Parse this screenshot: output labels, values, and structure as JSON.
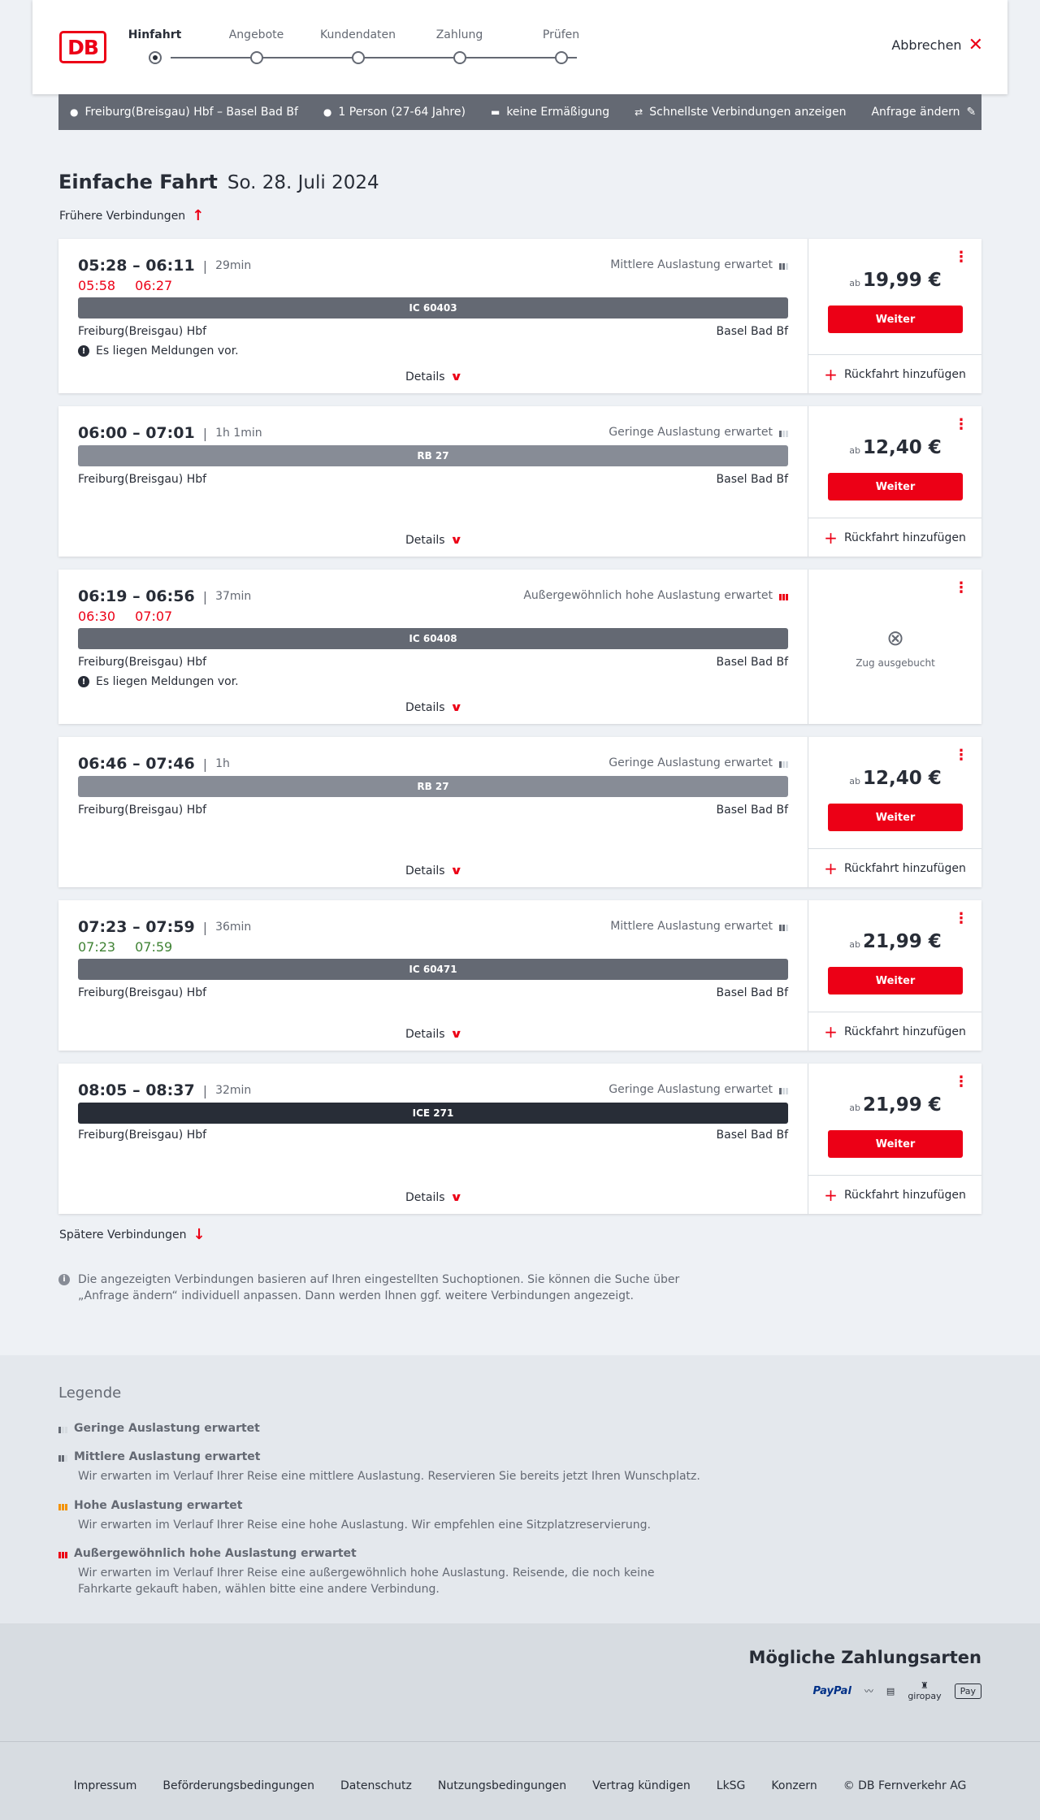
{
  "header": {
    "logo": "DB",
    "steps": [
      "Hinfahrt",
      "Angebote",
      "Kundendaten",
      "Zahlung",
      "Prüfen"
    ],
    "active_step": "Hinfahrt",
    "cancel_label": "Abbrechen"
  },
  "infobar": {
    "route": "Freiburg(Breisgau) Hbf – Basel Bad Bf",
    "persons": "1 Person (27-64 Jahre)",
    "discount": "keine Ermäßigung",
    "fastest": "Schnellste Verbindungen anzeigen",
    "change": "Anfrage ändern"
  },
  "page": {
    "title": "Einfache Fahrt",
    "date": "So. 28. Juli 2024",
    "earlier": "Frühere Verbindungen",
    "later": "Spätere Verbindungen",
    "hint": "Die angezeigten Verbindungen basieren auf Ihren eingestellten Suchoptionen. Sie können die Suche über „Anfrage ändern“ individuell anpassen. Dann werden Ihnen ggf. weitere Verbindungen angezeigt."
  },
  "labels": {
    "details": "Details",
    "weiter": "Weiter",
    "rueckfahrt": "Rückfahrt hinzufügen",
    "ab": "ab",
    "ausgebucht": "Zug ausgebucht",
    "meldungen": "Es liegen Meldungen vor."
  },
  "connections": [
    {
      "time": "05:28 – 06:11",
      "duration": "29min",
      "rt_dep": "05:58",
      "rt_arr": "06:27",
      "rt_status": "late",
      "load": "Mittlere Auslastung erwartet",
      "load_level": 2,
      "train": "IC 60403",
      "train_type": "ic",
      "from": "Freiburg(Breisgau) Hbf",
      "to": "Basel Bad Bf",
      "meldung": true,
      "price": "19,99 €",
      "booked_out": false
    },
    {
      "time": "06:00 – 07:01",
      "duration": "1h 1min",
      "rt_dep": "",
      "rt_arr": "",
      "rt_status": "none",
      "load": "Geringe Auslastung erwartet",
      "load_level": 1,
      "train": "RB 27",
      "train_type": "rb",
      "from": "Freiburg(Breisgau) Hbf",
      "to": "Basel Bad Bf",
      "meldung": false,
      "price": "12,40 €",
      "booked_out": false
    },
    {
      "time": "06:19 – 06:56",
      "duration": "37min",
      "rt_dep": "06:30",
      "rt_arr": "07:07",
      "rt_status": "late",
      "load": "Außergewöhnlich hohe Auslastung erwartet",
      "load_level": 4,
      "train": "IC 60408",
      "train_type": "ic",
      "from": "Freiburg(Breisgau) Hbf",
      "to": "Basel Bad Bf",
      "meldung": true,
      "price": "",
      "booked_out": true
    },
    {
      "time": "06:46 – 07:46",
      "duration": "1h",
      "rt_dep": "",
      "rt_arr": "",
      "rt_status": "none",
      "load": "Geringe Auslastung erwartet",
      "load_level": 1,
      "train": "RB 27",
      "train_type": "rb",
      "from": "Freiburg(Breisgau) Hbf",
      "to": "Basel Bad Bf",
      "meldung": false,
      "price": "12,40 €",
      "booked_out": false
    },
    {
      "time": "07:23 – 07:59",
      "duration": "36min",
      "rt_dep": "07:23",
      "rt_arr": "07:59",
      "rt_status": "ontime",
      "load": "Mittlere Auslastung erwartet",
      "load_level": 2,
      "train": "IC 60471",
      "train_type": "ic",
      "from": "Freiburg(Breisgau) Hbf",
      "to": "Basel Bad Bf",
      "meldung": false,
      "price": "21,99 €",
      "booked_out": false
    },
    {
      "time": "08:05 – 08:37",
      "duration": "32min",
      "rt_dep": "",
      "rt_arr": "",
      "rt_status": "none",
      "load": "Geringe Auslastung erwartet",
      "load_level": 1,
      "train": "ICE 271",
      "train_type": "ice",
      "from": "Freiburg(Breisgau) Hbf",
      "to": "Basel Bad Bf",
      "meldung": false,
      "price": "21,99 €",
      "booked_out": false
    }
  ],
  "legend": {
    "title": "Legende",
    "items": [
      {
        "title": "Geringe Auslastung erwartet",
        "desc": "",
        "level": 1
      },
      {
        "title": "Mittlere Auslastung erwartet",
        "desc": "Wir erwarten im Verlauf Ihrer Reise eine mittlere Auslastung. Reservieren Sie bereits jetzt Ihren Wunschplatz.",
        "level": 2
      },
      {
        "title": "Hohe Auslastung erwartet",
        "desc": "Wir erwarten im Verlauf Ihrer Reise eine hohe Auslastung. Wir empfehlen eine Sitzplatzreservierung.",
        "level": 3
      },
      {
        "title": "Außergewöhnlich hohe Auslastung erwartet",
        "desc": "Wir erwarten im Verlauf Ihrer Reise eine außergewöhnlich hohe Auslastung. Reisende, die noch keine Fahrkarte gekauft haben, wählen bitte eine andere Verbindung.",
        "level": 4
      }
    ]
  },
  "payment": {
    "title": "Mögliche Zahlungsarten",
    "methods": [
      "PayPal",
      "giropay",
      "Pay"
    ]
  },
  "footer": {
    "links": [
      "Impressum",
      "Beförderungsbedingungen",
      "Datenschutz",
      "Nutzungsbedingungen",
      "Vertrag kündigen",
      "LkSG",
      "Konzern",
      "© DB Fernverkehr AG"
    ]
  },
  "colors": {
    "brand": "#ec0016",
    "late": "#ec0016",
    "ontime": "#408335",
    "high": "#f39200"
  }
}
